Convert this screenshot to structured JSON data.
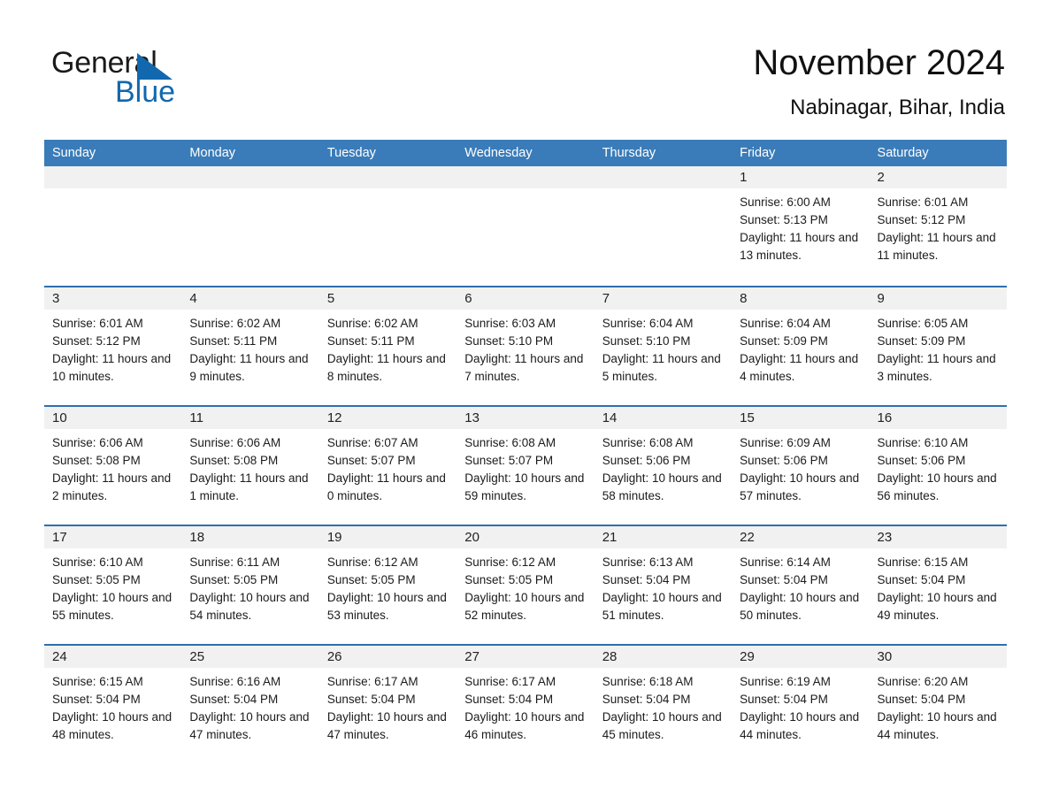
{
  "brand": {
    "name_part1": "General",
    "name_part2": "Blue",
    "triangle_icon": "triangle-icon",
    "accent_color": "#1168ae"
  },
  "header": {
    "title": "November 2024",
    "location": "Nabinagar, Bihar, India"
  },
  "theme": {
    "header_bg": "#3a7cb9",
    "row_border": "#2f6fae",
    "daynum_band": "#f1f1f1",
    "text": "#1b1b1b"
  },
  "weekdays": [
    "Sunday",
    "Monday",
    "Tuesday",
    "Wednesday",
    "Thursday",
    "Friday",
    "Saturday"
  ],
  "weeks": [
    [
      {
        "day": "",
        "sunrise": "",
        "sunset": "",
        "daylight": ""
      },
      {
        "day": "",
        "sunrise": "",
        "sunset": "",
        "daylight": ""
      },
      {
        "day": "",
        "sunrise": "",
        "sunset": "",
        "daylight": ""
      },
      {
        "day": "",
        "sunrise": "",
        "sunset": "",
        "daylight": ""
      },
      {
        "day": "",
        "sunrise": "",
        "sunset": "",
        "daylight": ""
      },
      {
        "day": "1",
        "sunrise": "Sunrise: 6:00 AM",
        "sunset": "Sunset: 5:13 PM",
        "daylight": "Daylight: 11 hours and 13 minutes."
      },
      {
        "day": "2",
        "sunrise": "Sunrise: 6:01 AM",
        "sunset": "Sunset: 5:12 PM",
        "daylight": "Daylight: 11 hours and 11 minutes."
      }
    ],
    [
      {
        "day": "3",
        "sunrise": "Sunrise: 6:01 AM",
        "sunset": "Sunset: 5:12 PM",
        "daylight": "Daylight: 11 hours and 10 minutes."
      },
      {
        "day": "4",
        "sunrise": "Sunrise: 6:02 AM",
        "sunset": "Sunset: 5:11 PM",
        "daylight": "Daylight: 11 hours and 9 minutes."
      },
      {
        "day": "5",
        "sunrise": "Sunrise: 6:02 AM",
        "sunset": "Sunset: 5:11 PM",
        "daylight": "Daylight: 11 hours and 8 minutes."
      },
      {
        "day": "6",
        "sunrise": "Sunrise: 6:03 AM",
        "sunset": "Sunset: 5:10 PM",
        "daylight": "Daylight: 11 hours and 7 minutes."
      },
      {
        "day": "7",
        "sunrise": "Sunrise: 6:04 AM",
        "sunset": "Sunset: 5:10 PM",
        "daylight": "Daylight: 11 hours and 5 minutes."
      },
      {
        "day": "8",
        "sunrise": "Sunrise: 6:04 AM",
        "sunset": "Sunset: 5:09 PM",
        "daylight": "Daylight: 11 hours and 4 minutes."
      },
      {
        "day": "9",
        "sunrise": "Sunrise: 6:05 AM",
        "sunset": "Sunset: 5:09 PM",
        "daylight": "Daylight: 11 hours and 3 minutes."
      }
    ],
    [
      {
        "day": "10",
        "sunrise": "Sunrise: 6:06 AM",
        "sunset": "Sunset: 5:08 PM",
        "daylight": "Daylight: 11 hours and 2 minutes."
      },
      {
        "day": "11",
        "sunrise": "Sunrise: 6:06 AM",
        "sunset": "Sunset: 5:08 PM",
        "daylight": "Daylight: 11 hours and 1 minute."
      },
      {
        "day": "12",
        "sunrise": "Sunrise: 6:07 AM",
        "sunset": "Sunset: 5:07 PM",
        "daylight": "Daylight: 11 hours and 0 minutes."
      },
      {
        "day": "13",
        "sunrise": "Sunrise: 6:08 AM",
        "sunset": "Sunset: 5:07 PM",
        "daylight": "Daylight: 10 hours and 59 minutes."
      },
      {
        "day": "14",
        "sunrise": "Sunrise: 6:08 AM",
        "sunset": "Sunset: 5:06 PM",
        "daylight": "Daylight: 10 hours and 58 minutes."
      },
      {
        "day": "15",
        "sunrise": "Sunrise: 6:09 AM",
        "sunset": "Sunset: 5:06 PM",
        "daylight": "Daylight: 10 hours and 57 minutes."
      },
      {
        "day": "16",
        "sunrise": "Sunrise: 6:10 AM",
        "sunset": "Sunset: 5:06 PM",
        "daylight": "Daylight: 10 hours and 56 minutes."
      }
    ],
    [
      {
        "day": "17",
        "sunrise": "Sunrise: 6:10 AM",
        "sunset": "Sunset: 5:05 PM",
        "daylight": "Daylight: 10 hours and 55 minutes."
      },
      {
        "day": "18",
        "sunrise": "Sunrise: 6:11 AM",
        "sunset": "Sunset: 5:05 PM",
        "daylight": "Daylight: 10 hours and 54 minutes."
      },
      {
        "day": "19",
        "sunrise": "Sunrise: 6:12 AM",
        "sunset": "Sunset: 5:05 PM",
        "daylight": "Daylight: 10 hours and 53 minutes."
      },
      {
        "day": "20",
        "sunrise": "Sunrise: 6:12 AM",
        "sunset": "Sunset: 5:05 PM",
        "daylight": "Daylight: 10 hours and 52 minutes."
      },
      {
        "day": "21",
        "sunrise": "Sunrise: 6:13 AM",
        "sunset": "Sunset: 5:04 PM",
        "daylight": "Daylight: 10 hours and 51 minutes."
      },
      {
        "day": "22",
        "sunrise": "Sunrise: 6:14 AM",
        "sunset": "Sunset: 5:04 PM",
        "daylight": "Daylight: 10 hours and 50 minutes."
      },
      {
        "day": "23",
        "sunrise": "Sunrise: 6:15 AM",
        "sunset": "Sunset: 5:04 PM",
        "daylight": "Daylight: 10 hours and 49 minutes."
      }
    ],
    [
      {
        "day": "24",
        "sunrise": "Sunrise: 6:15 AM",
        "sunset": "Sunset: 5:04 PM",
        "daylight": "Daylight: 10 hours and 48 minutes."
      },
      {
        "day": "25",
        "sunrise": "Sunrise: 6:16 AM",
        "sunset": "Sunset: 5:04 PM",
        "daylight": "Daylight: 10 hours and 47 minutes."
      },
      {
        "day": "26",
        "sunrise": "Sunrise: 6:17 AM",
        "sunset": "Sunset: 5:04 PM",
        "daylight": "Daylight: 10 hours and 47 minutes."
      },
      {
        "day": "27",
        "sunrise": "Sunrise: 6:17 AM",
        "sunset": "Sunset: 5:04 PM",
        "daylight": "Daylight: 10 hours and 46 minutes."
      },
      {
        "day": "28",
        "sunrise": "Sunrise: 6:18 AM",
        "sunset": "Sunset: 5:04 PM",
        "daylight": "Daylight: 10 hours and 45 minutes."
      },
      {
        "day": "29",
        "sunrise": "Sunrise: 6:19 AM",
        "sunset": "Sunset: 5:04 PM",
        "daylight": "Daylight: 10 hours and 44 minutes."
      },
      {
        "day": "30",
        "sunrise": "Sunrise: 6:20 AM",
        "sunset": "Sunset: 5:04 PM",
        "daylight": "Daylight: 10 hours and 44 minutes."
      }
    ]
  ]
}
